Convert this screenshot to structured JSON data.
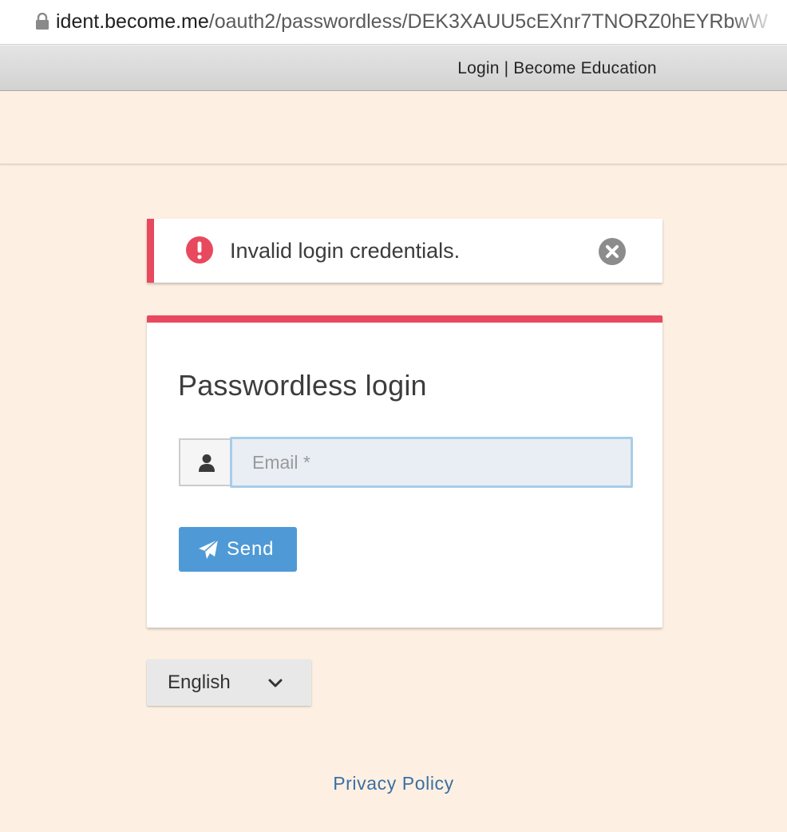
{
  "browser": {
    "url_host": "ident.become.me",
    "url_path": "/oauth2/passwordless/DEK3XAUU5cEXnr7TNORZ0hEYRbwW",
    "icons": {
      "lock": "lock-icon"
    }
  },
  "window": {
    "title": "Login | Become Education"
  },
  "alert": {
    "message": "Invalid login credentials.",
    "type": "error",
    "icons": {
      "status": "exclamation-circle-icon",
      "close": "close-circle-icon"
    }
  },
  "login": {
    "title": "Passwordless login",
    "email": {
      "value": "",
      "placeholder": "Email *",
      "icon": "user-icon"
    },
    "send_label": "Send",
    "send_icon": "paper-plane-icon"
  },
  "language": {
    "selected": "English",
    "icon": "chevron-down-icon"
  },
  "footer": {
    "privacy_label": "Privacy Policy"
  },
  "colors": {
    "accent_red": "#e8495e",
    "primary_blue": "#4f9ad6",
    "link_blue": "#3b6fa5",
    "background": "#fdf0e2"
  }
}
